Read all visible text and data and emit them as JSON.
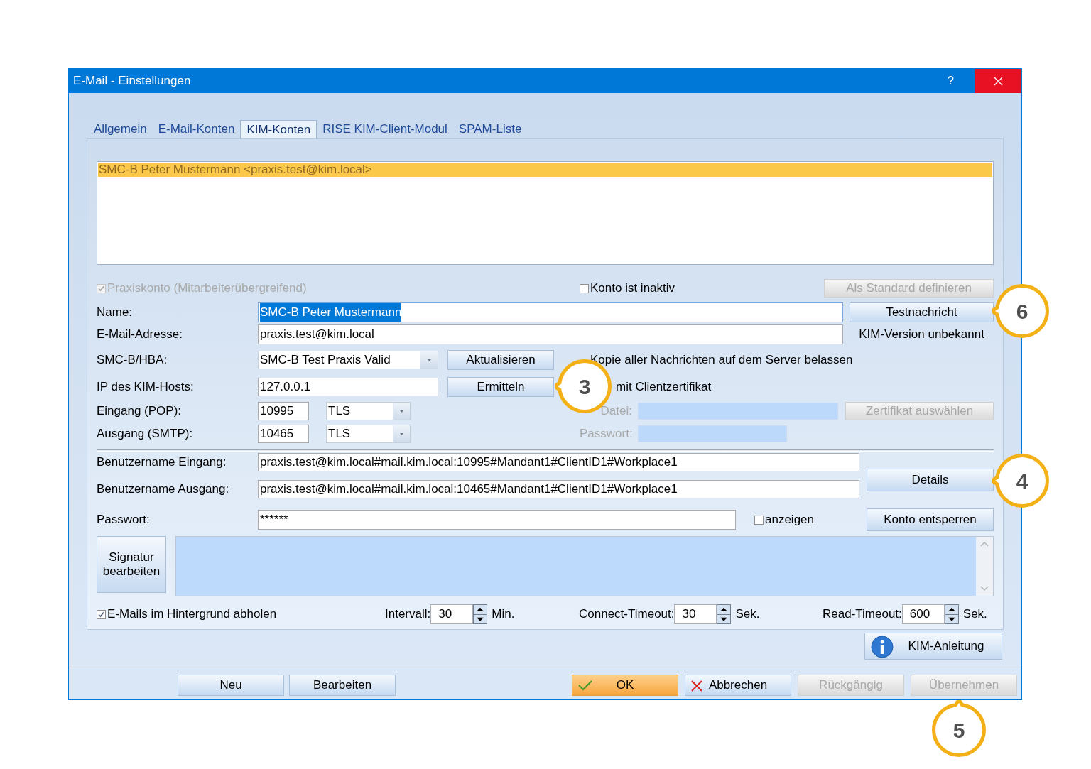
{
  "window": {
    "title": "E-Mail - Einstellungen",
    "help": "?"
  },
  "tabs": [
    {
      "label": "Allgemein",
      "selected": false
    },
    {
      "label": "E-Mail-Konten",
      "selected": false
    },
    {
      "label": "KIM-Konten",
      "selected": true
    },
    {
      "label": "RISE KIM-Client-Modul",
      "selected": false
    },
    {
      "label": "SPAM-Liste",
      "selected": false
    }
  ],
  "accounts": [
    {
      "label": "SMC-B Peter Mustermann <praxis.test@kim.local>",
      "selected": true
    }
  ],
  "practice_account": {
    "label": "Praxiskonto (Mitarbeiterübergreifend)",
    "checked": true,
    "disabled": true
  },
  "inactive": {
    "label": "Konto ist inaktiv",
    "checked": false
  },
  "standard_button": {
    "label": "Als Standard definieren",
    "disabled": true
  },
  "name": {
    "label": "Name:",
    "value": "SMC-B Peter Mustermann",
    "text_selected": true
  },
  "test_button": {
    "label": "Testnachricht",
    "disabled": false
  },
  "email": {
    "label": "E-Mail-Adresse:",
    "value": "praxis.test@kim.local"
  },
  "kim_version": "KIM-Version unbekannt",
  "smcb": {
    "label": "SMC-B/HBA:",
    "value": "SMC-B Test Praxis Valid"
  },
  "refresh_button": {
    "label": "Aktualisieren",
    "disabled": false
  },
  "keep_copy": {
    "label": "Kopie aller Nachrichten auf dem Server belassen"
  },
  "host": {
    "label": "IP des KIM-Hosts:",
    "value": "127.0.0.1"
  },
  "detect_button": {
    "label": "Ermitteln",
    "disabled": false
  },
  "client_cert": {
    "label": "mit Clientzertifikat"
  },
  "ports": [
    {
      "label": "Eingang (POP):",
      "port": "10995",
      "security": "TLS"
    },
    {
      "label": "Ausgang (SMTP):",
      "port": "10465",
      "security": "TLS"
    }
  ],
  "cert_file": {
    "label": "Datei:",
    "disabled": true
  },
  "cert_button": {
    "label": "Zertifikat auswählen",
    "disabled": true
  },
  "cert_password": {
    "label": "Passwort:",
    "disabled": true
  },
  "usernames": [
    {
      "label": "Benutzername Eingang:",
      "value": "praxis.test@kim.local#mail.kim.local:10995#Mandant1#ClientID1#Workplace1"
    },
    {
      "label": "Benutzername Ausgang:",
      "value": "praxis.test@kim.local#mail.kim.local:10465#Mandant1#ClientID1#Workplace1"
    }
  ],
  "details_button": {
    "label": "Details",
    "disabled": false
  },
  "password": {
    "label": "Passwort:",
    "value": "******"
  },
  "show_password": {
    "label": "anzeigen",
    "checked": false
  },
  "unlock_button": {
    "label": "Konto entsperren",
    "disabled": false
  },
  "signature_button": {
    "label": "Signatur bearbeiten",
    "disabled": false
  },
  "background_fetch": {
    "label": "E-Mails im Hintergrund abholen",
    "checked": true
  },
  "timers": [
    {
      "label": "Intervall:",
      "value": "30",
      "unit": "Min."
    },
    {
      "label": "Connect-Timeout:",
      "value": "30",
      "unit": "Sek."
    },
    {
      "label": "Read-Timeout:",
      "value": "600",
      "unit": "Sek."
    }
  ],
  "guide_button": {
    "label": "KIM-Anleitung",
    "disabled": false
  },
  "footer_left": [
    {
      "label": "Neu",
      "kind": "plain",
      "disabled": false
    },
    {
      "label": "Bearbeiten",
      "kind": "plain",
      "disabled": false
    }
  ],
  "footer_right": [
    {
      "label": "OK",
      "kind": "ok",
      "disabled": false
    },
    {
      "label": "Abbrechen",
      "kind": "cancel",
      "disabled": false
    },
    {
      "label": "Rückgängig",
      "kind": "plain",
      "disabled": true
    },
    {
      "label": "Übernehmen",
      "kind": "plain",
      "disabled": true
    }
  ],
  "callouts": [
    {
      "label": "3",
      "kind": "left"
    },
    {
      "label": "6",
      "kind": "left"
    },
    {
      "label": "4",
      "kind": "left"
    },
    {
      "label": "5",
      "kind": "up"
    }
  ]
}
